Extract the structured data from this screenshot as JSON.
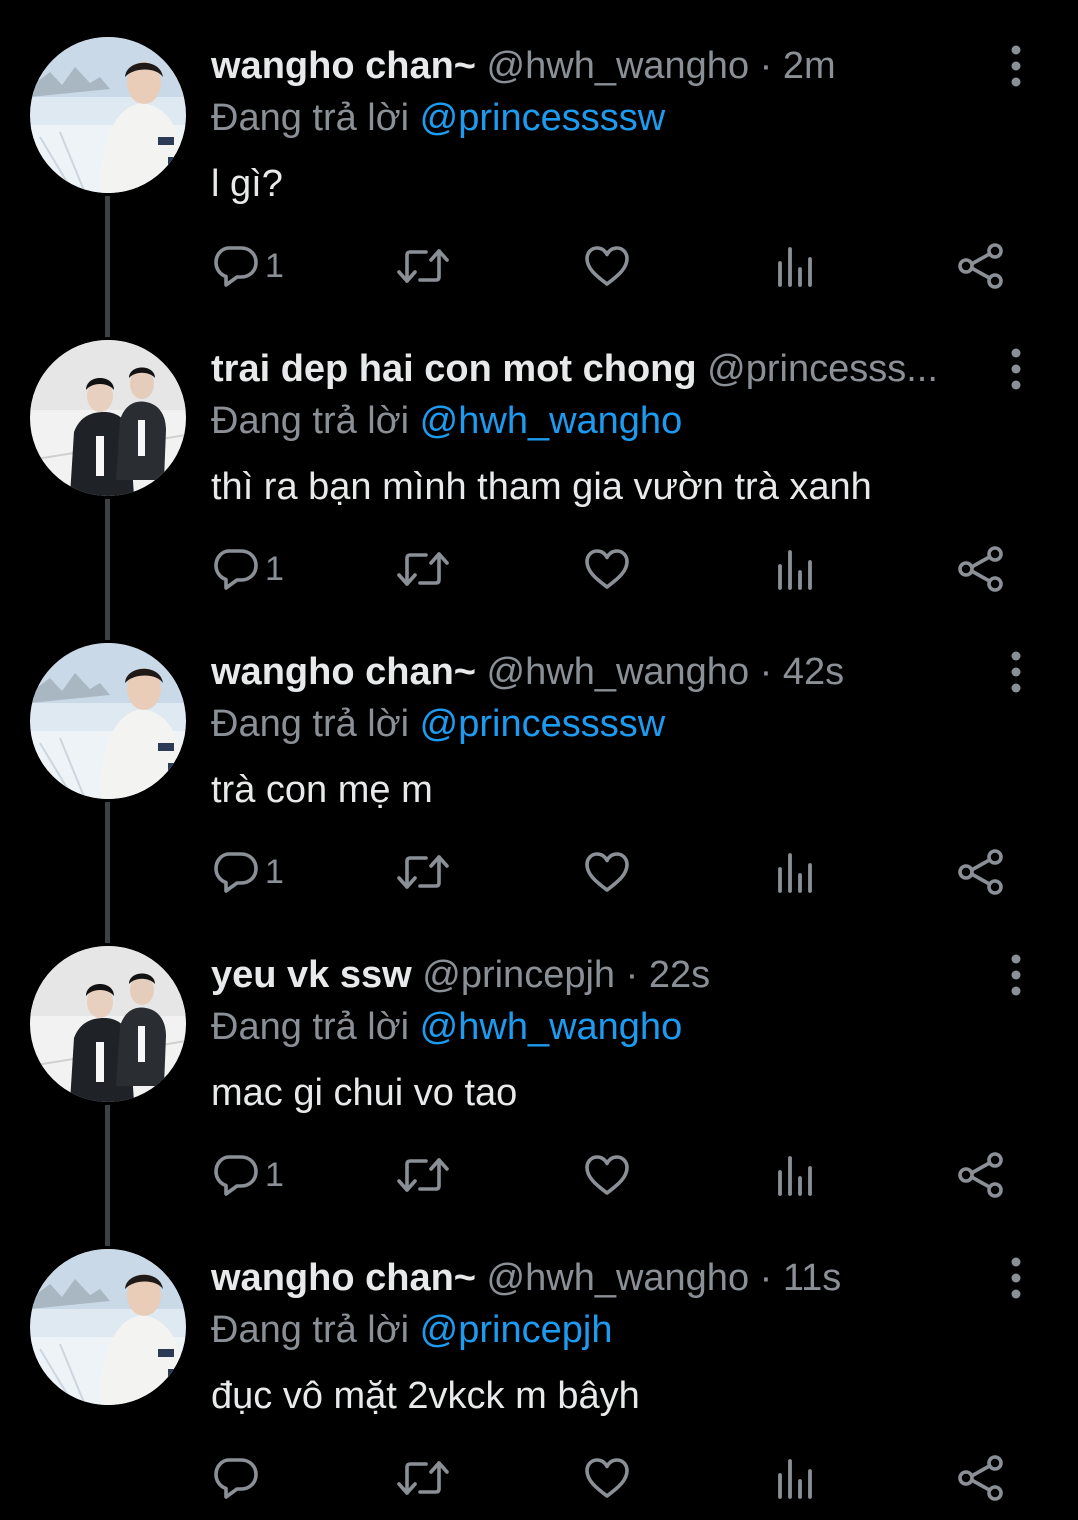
{
  "tweets": [
    {
      "display_name": "wangho chan~",
      "handle": "@hwh_wangho",
      "separator": "·",
      "time": "2m",
      "reply_prefix": "Đang trả lời",
      "reply_to": "@princessssw",
      "text": "l gì?",
      "reply_count": "1",
      "avatar": "wangho-avatar"
    },
    {
      "display_name": "trai dep hai con mot chong",
      "handle": "@princesss...",
      "separator": "",
      "time": "",
      "reply_prefix": "Đang trả lời",
      "reply_to": "@hwh_wangho",
      "text": "thì ra bạn mình tham gia vườn trà xanh",
      "reply_count": "1",
      "avatar": "prince-avatar"
    },
    {
      "display_name": "wangho chan~",
      "handle": "@hwh_wangho",
      "separator": "·",
      "time": "42s",
      "reply_prefix": "Đang trả lời",
      "reply_to": "@princessssw",
      "text": "trà con mẹ m",
      "reply_count": "1",
      "avatar": "wangho-avatar"
    },
    {
      "display_name": "yeu vk ssw",
      "handle": "@princepjh",
      "separator": "·",
      "time": "22s",
      "reply_prefix": "Đang trả lời",
      "reply_to": "@hwh_wangho",
      "text": "mac gi chui vo tao",
      "reply_count": "1",
      "avatar": "prince-avatar"
    },
    {
      "display_name": "wangho chan~",
      "handle": "@hwh_wangho",
      "separator": "·",
      "time": "11s",
      "reply_prefix": "Đang trả lời",
      "reply_to": "@princepjh",
      "text": "đục vô mặt 2vkck m bâyh",
      "reply_count": "",
      "avatar": "wangho-avatar"
    }
  ],
  "icons": {
    "reply": "reply-icon",
    "retweet": "retweet-icon",
    "like": "heart-icon",
    "views": "views-icon",
    "share": "share-icon",
    "more": "more-icon"
  },
  "colors": {
    "background": "#000000",
    "primary_text": "#e7e9ea",
    "secondary_text": "#8b9096",
    "mention": "#1d9bf0",
    "thread_line": "#3e4144"
  }
}
